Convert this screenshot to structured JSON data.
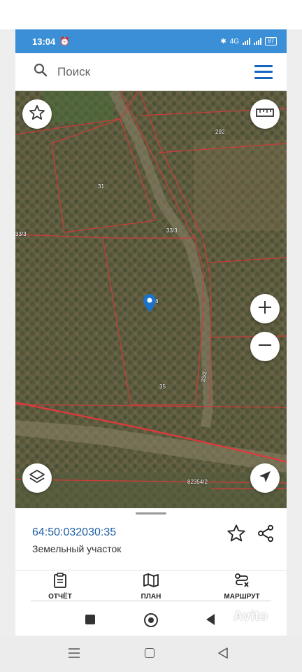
{
  "status": {
    "time": "13:04",
    "network": "4G",
    "battery": "87"
  },
  "search": {
    "placeholder": "Поиск"
  },
  "map": {
    "parcel_labels": [
      "292",
      "31",
      "33/3",
      "33/3",
      "6",
      "33/2",
      "35",
      "82354/2"
    ],
    "boundary_color": "#e03030"
  },
  "parcel": {
    "cadastral_number": "64:50:032030:35",
    "type": "Земельный участок"
  },
  "tabs": [
    {
      "label": "ОТЧЁТ",
      "icon": "clipboard-icon"
    },
    {
      "label": "ПЛАН",
      "icon": "map-icon"
    },
    {
      "label": "МАРШРУТ",
      "icon": "route-icon"
    }
  ],
  "watermark": "Avito",
  "colors": {
    "accent": "#3b8fd6",
    "menu": "#1565c0",
    "link": "#1e5fa8",
    "pin": "#1a73c8"
  }
}
